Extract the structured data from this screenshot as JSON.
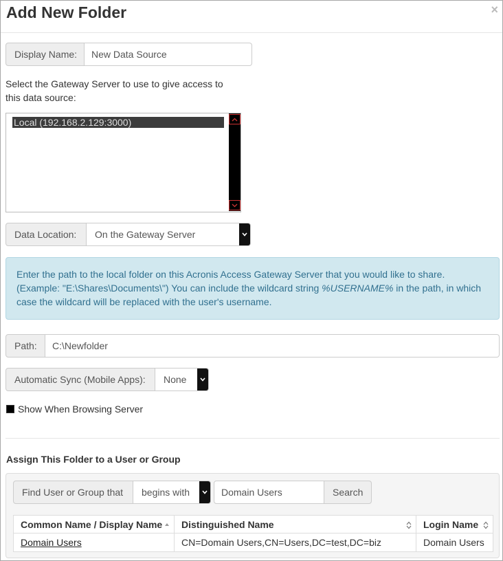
{
  "dialog": {
    "title": "Add New Folder",
    "close_label": "×"
  },
  "display_name": {
    "label": "Display Name:",
    "value": "New Data Source"
  },
  "gateway": {
    "instruction": "Select the Gateway Server to use to give access to this data source:",
    "options": [
      "Local (192.168.2.129:3000)"
    ],
    "selected": "Local (192.168.2.129:3000)"
  },
  "data_location": {
    "label": "Data Location:",
    "value": "On the Gateway Server"
  },
  "info": {
    "line1": "Enter the path to the local folder on this Acronis Access Gateway Server that you would like to share.",
    "line2_pre": "(Example: \"E:\\Shares\\Documents\\\") You can include the wildcard string ",
    "wildcard": "%USERNAME%",
    "line2_post": " in the path, in which case the wildcard will be replaced with the user's username."
  },
  "path": {
    "label": "Path:",
    "value": "C:\\Newfolder"
  },
  "auto_sync": {
    "label": "Automatic Sync (Mobile Apps):",
    "value": "None"
  },
  "show_browsing": {
    "label": "Show When Browsing Server",
    "checked": true
  },
  "assign": {
    "title": "Assign This Folder to a User or Group",
    "find_label": "Find User or Group that",
    "match_mode": "begins with",
    "query": "Domain Users",
    "search_button": "Search",
    "columns": [
      "Common Name / Display Name",
      "Distinguished Name",
      "Login Name"
    ],
    "rows": [
      {
        "common_name": "Domain Users",
        "distinguished_name": "CN=Domain Users,CN=Users,DC=test,DC=biz",
        "login_name": "Domain Users"
      }
    ]
  },
  "colors": {
    "info_bg": "#d1e8ef",
    "info_text": "#31708f",
    "addon_bg": "#eeeeee",
    "border": "#cccccc"
  }
}
